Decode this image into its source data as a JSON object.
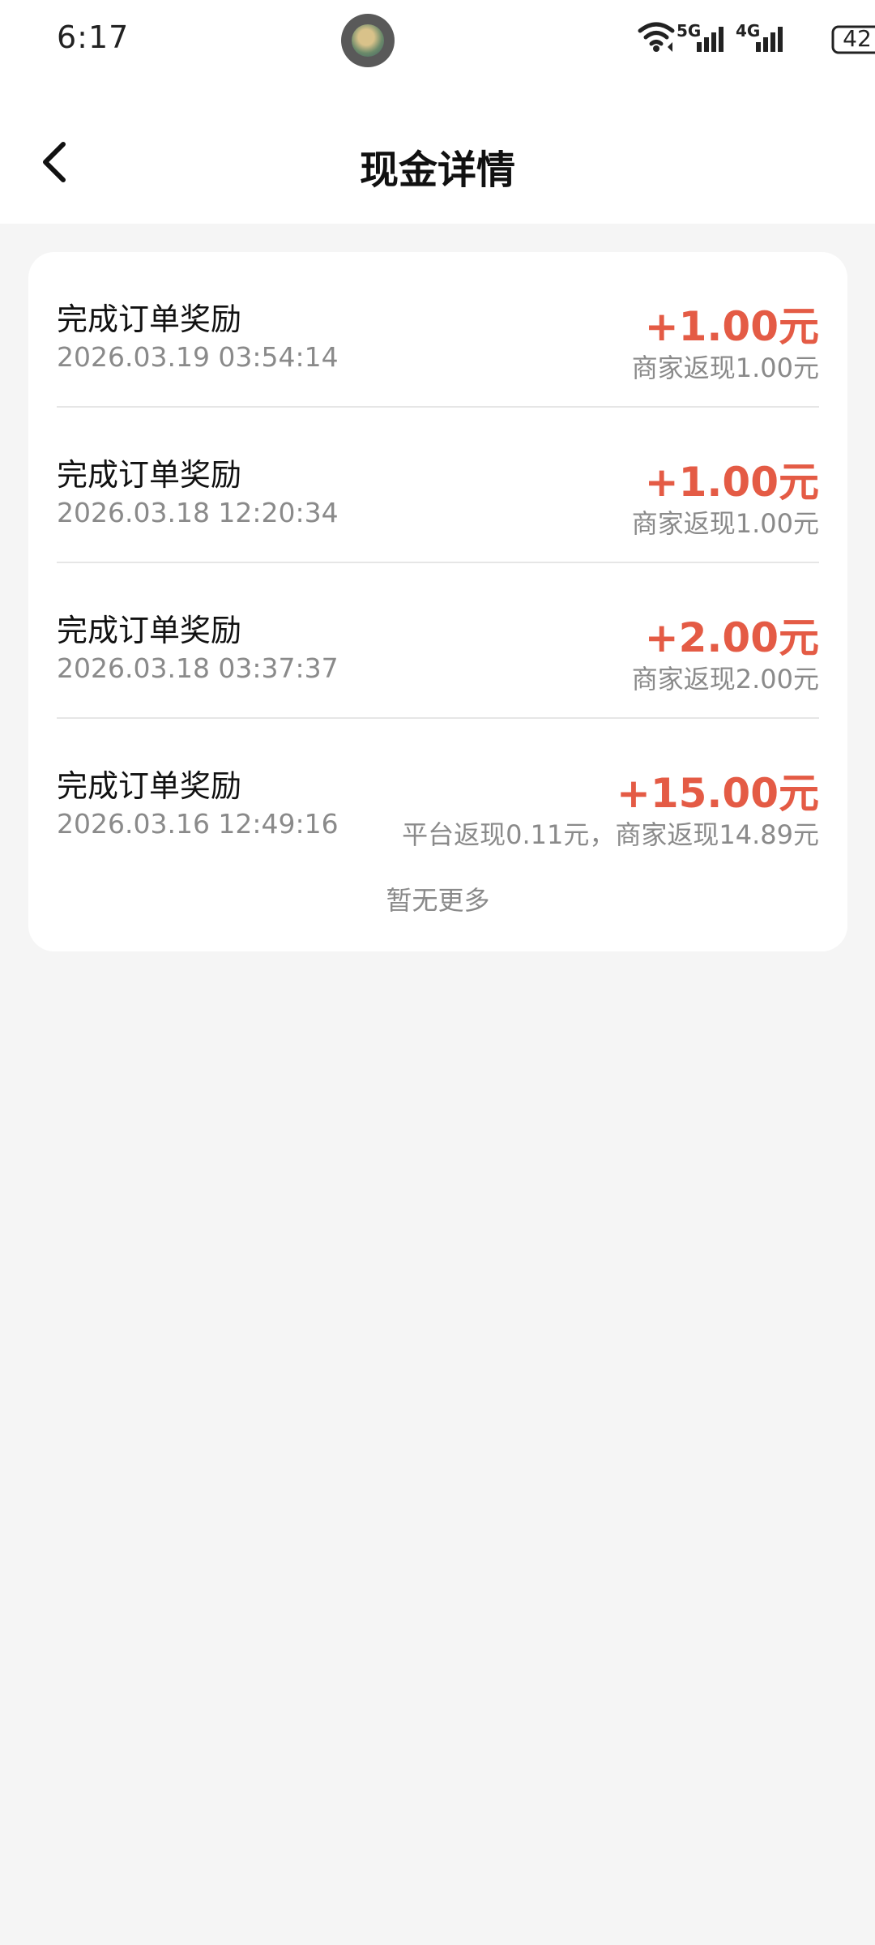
{
  "status_bar": {
    "time": "6:17",
    "battery": "42",
    "network_5g": "5G",
    "network_4g": "4G",
    "icons": [
      "wifi-icon",
      "signal-5g-icon",
      "signal-4g-icon",
      "battery-icon"
    ]
  },
  "header": {
    "title": "现金详情",
    "back_icon": "chevron-left-icon"
  },
  "records": [
    {
      "title": "完成订单奖励",
      "datetime": "2026.03.19 03:54:14",
      "amount": "+1.00元",
      "detail": "商家返现1.00元"
    },
    {
      "title": "完成订单奖励",
      "datetime": "2026.03.18 12:20:34",
      "amount": "+1.00元",
      "detail": "商家返现1.00元"
    },
    {
      "title": "完成订单奖励",
      "datetime": "2026.03.18 03:37:37",
      "amount": "+2.00元",
      "detail": "商家返现2.00元"
    },
    {
      "title": "完成订单奖励",
      "datetime": "2026.03.16 12:49:16",
      "amount": "+15.00元",
      "detail": "平台返现0.11元，商家返现14.89元"
    }
  ],
  "footer": {
    "no_more": "暂无更多"
  },
  "colors": {
    "accent_amount": "#e45b45",
    "page_background": "#f5f5f5",
    "card_background": "#ffffff",
    "secondary_text": "#8a8a8a"
  }
}
